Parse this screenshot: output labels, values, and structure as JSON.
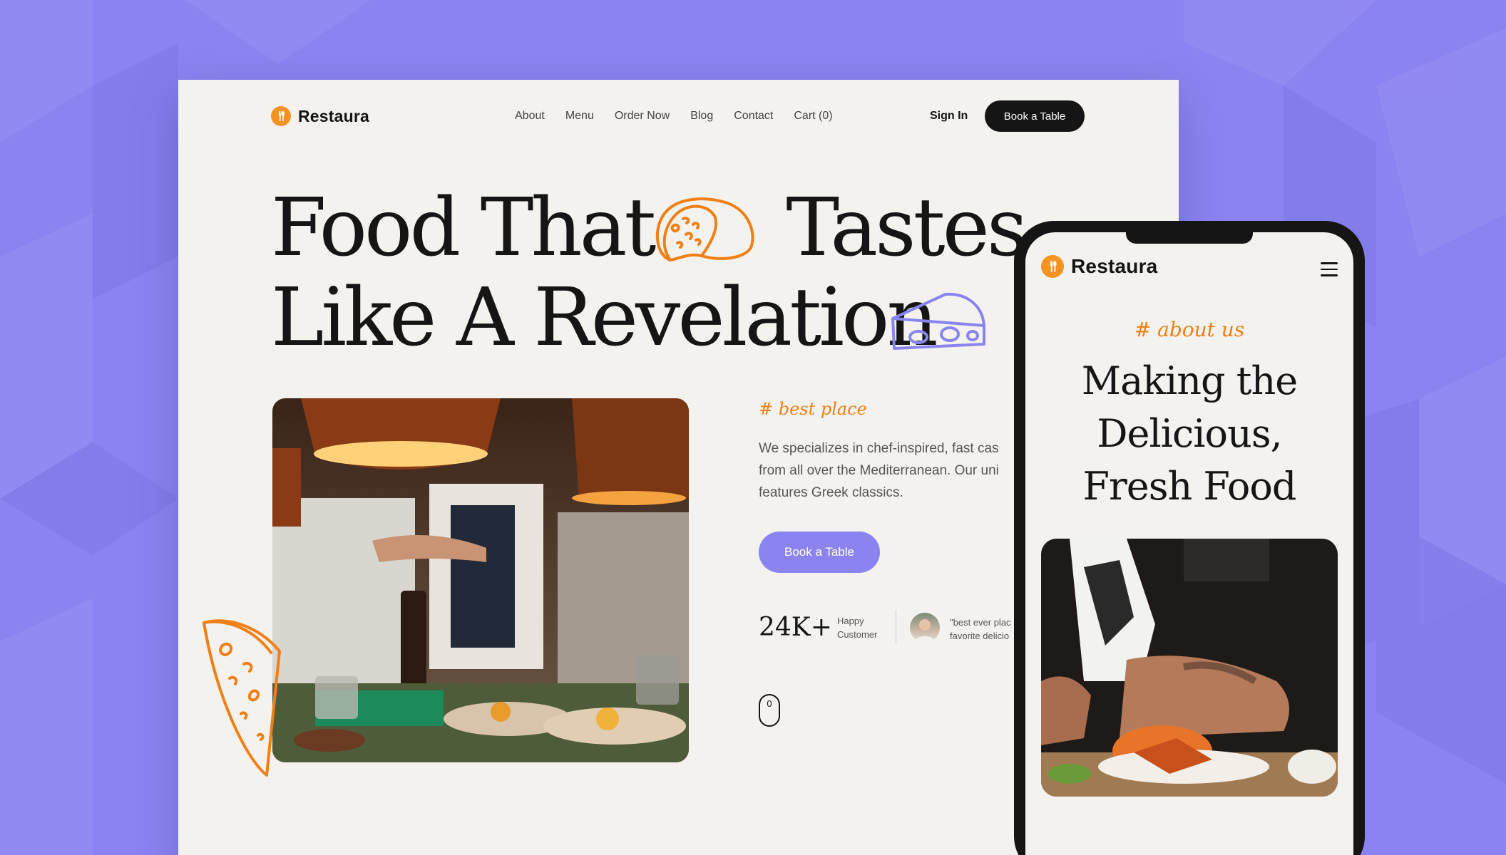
{
  "brand": {
    "name": "Restaura",
    "accent": "#f59222",
    "purple": "#8b84f0",
    "dark": "#151515"
  },
  "nav": {
    "links": [
      "About",
      "Menu",
      "Order Now",
      "Blog",
      "Contact",
      "Cart (0)"
    ],
    "sign_in": "Sign In",
    "book_table": "Book a Table"
  },
  "hero": {
    "title_line1": "Food That",
    "title_line1b": "Tastes",
    "title_line2": "Like A Revelation",
    "tag": "# best place",
    "description": [
      "We specializes in chef-inspired, fast cas",
      "from all over the Mediterranean. Our uni",
      "features Greek classics."
    ],
    "cta": "Book a Table",
    "stat_value": "24K+",
    "stat_label": "Happy Customer",
    "quote_lines": [
      "\"best ever plac",
      "favorite delicio"
    ],
    "scroll_indicator": "0"
  },
  "mobile": {
    "brand": "Restaura",
    "tag": "# about us",
    "title_lines": [
      "Making the",
      "Delicious,",
      "Fresh Food"
    ]
  },
  "icons": {
    "logo": "fork-spoon-icon",
    "menu": "hamburger-icon",
    "taco": "taco-icon",
    "cheese": "cheese-icon",
    "pizza": "pizza-slice-icon",
    "scroll": "mouse-icon"
  }
}
